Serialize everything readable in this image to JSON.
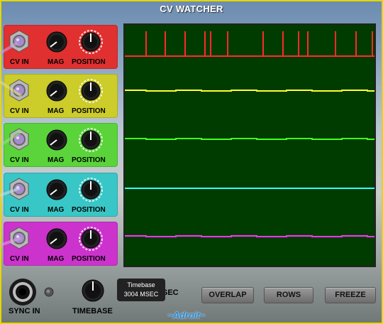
{
  "title": "CV WATCHER",
  "channels": [
    {
      "color": "#e03030",
      "trace": "#ff2a2a",
      "cv_label": "CV IN",
      "mag_label": "MAG",
      "pos_label": "POSITION",
      "wave": "pulse"
    },
    {
      "color": "#cccc2a",
      "trace": "#ffff33",
      "cv_label": "CV IN",
      "mag_label": "MAG",
      "pos_label": "POSITION",
      "wave": "square"
    },
    {
      "color": "#5ad43a",
      "trace": "#44ff22",
      "cv_label": "CV IN",
      "mag_label": "MAG",
      "pos_label": "POSITION",
      "wave": "square"
    },
    {
      "color": "#39c6c6",
      "trace": "#33ffff",
      "cv_label": "CV IN",
      "mag_label": "MAG",
      "pos_label": "POSITION",
      "wave": "square"
    },
    {
      "color": "#cc33cc",
      "trace": "#ff33ff",
      "cv_label": "CV IN",
      "mag_label": "MAG",
      "pos_label": "POSITION",
      "wave": "square"
    }
  ],
  "sync_label": "SYNC IN",
  "timebase_label": "TIMEBASE",
  "tooltip": {
    "line1": "Timebase",
    "line2": "3004 MSEC"
  },
  "partial_label": "SEC",
  "buttons": {
    "overlap": "OVERLAP",
    "rows": "ROWS",
    "freeze": "FREEZE"
  },
  "brand": "~Adroit~"
}
